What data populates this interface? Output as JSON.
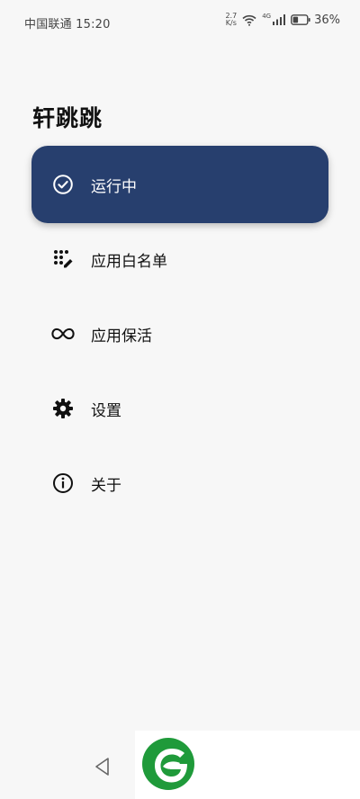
{
  "status": {
    "carrier_time": "中国联通 15:20",
    "speed_value": "2.7",
    "speed_unit": "K/s",
    "network": "4G",
    "battery": "36%"
  },
  "app": {
    "title": "轩跳跳"
  },
  "menu": {
    "items": [
      {
        "label": "运行中",
        "icon": "check-circle-icon",
        "active": true
      },
      {
        "label": "应用白名单",
        "icon": "dots-pen-icon",
        "active": false
      },
      {
        "label": "应用保活",
        "icon": "infinity-icon",
        "active": false
      },
      {
        "label": "设置",
        "icon": "gear-icon",
        "active": false
      },
      {
        "label": "关于",
        "icon": "info-icon",
        "active": false
      }
    ]
  },
  "colors": {
    "active_bg": "#273f6e",
    "logo_green": "#1f9a3a"
  }
}
